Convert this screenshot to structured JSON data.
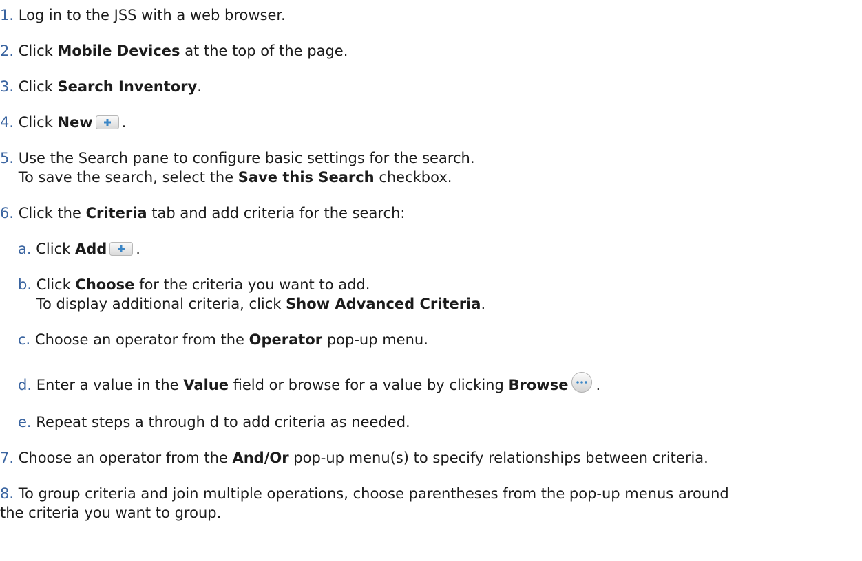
{
  "steps": [
    {
      "num": "1.",
      "parts": [
        "Log in to the JSS with a web browser."
      ]
    },
    {
      "num": "2.",
      "parts": [
        "Click ",
        "Mobile Devices",
        " at the top of the page."
      ]
    },
    {
      "num": "3.",
      "parts": [
        "Click ",
        "Search Inventory",
        "."
      ]
    },
    {
      "num": "4.",
      "parts": [
        "Click ",
        "New",
        "."
      ]
    },
    {
      "num": "5.",
      "parts": [
        "Use the Search pane to configure basic settings for the search."
      ],
      "cont": [
        "To save the search, select the ",
        "Save this Search",
        " checkbox."
      ]
    },
    {
      "num": "6.",
      "parts": [
        "Click the ",
        "Criteria",
        " tab and add criteria for the search:"
      ],
      "substeps": [
        {
          "num": "a.",
          "parts": [
            "Click ",
            "Add",
            "."
          ]
        },
        {
          "num": "b.",
          "parts": [
            "Click ",
            "Choose",
            " for the criteria you want to add."
          ],
          "cont": [
            "To display additional criteria, click ",
            "Show Advanced Criteria",
            "."
          ]
        },
        {
          "num": "c.",
          "parts": [
            "Choose an operator from the ",
            "Operator",
            " pop-up menu."
          ]
        },
        {
          "num": "d.",
          "parts": [
            "Enter a value in the ",
            "Value",
            " field or browse for a value by clicking ",
            "Browse",
            "."
          ]
        },
        {
          "num": "e.",
          "parts": [
            "Repeat steps a through d to add criteria as needed."
          ]
        }
      ]
    },
    {
      "num": "7.",
      "parts": [
        "Choose an operator from the ",
        "And/Or",
        " pop-up menu(s) to specify relationships between criteria."
      ]
    },
    {
      "num": "8.",
      "parts": [
        "To group criteria and join multiple operations, choose parentheses from the pop-up menus around"
      ],
      "cont": [
        "the criteria you want to group."
      ]
    }
  ],
  "icons": {
    "add_button": "plus-button-icon",
    "browse_button": "ellipsis-button-icon"
  },
  "colors": {
    "number": "#3a64a0",
    "text": "#1c1c1c",
    "plus": "#3b86c6"
  }
}
